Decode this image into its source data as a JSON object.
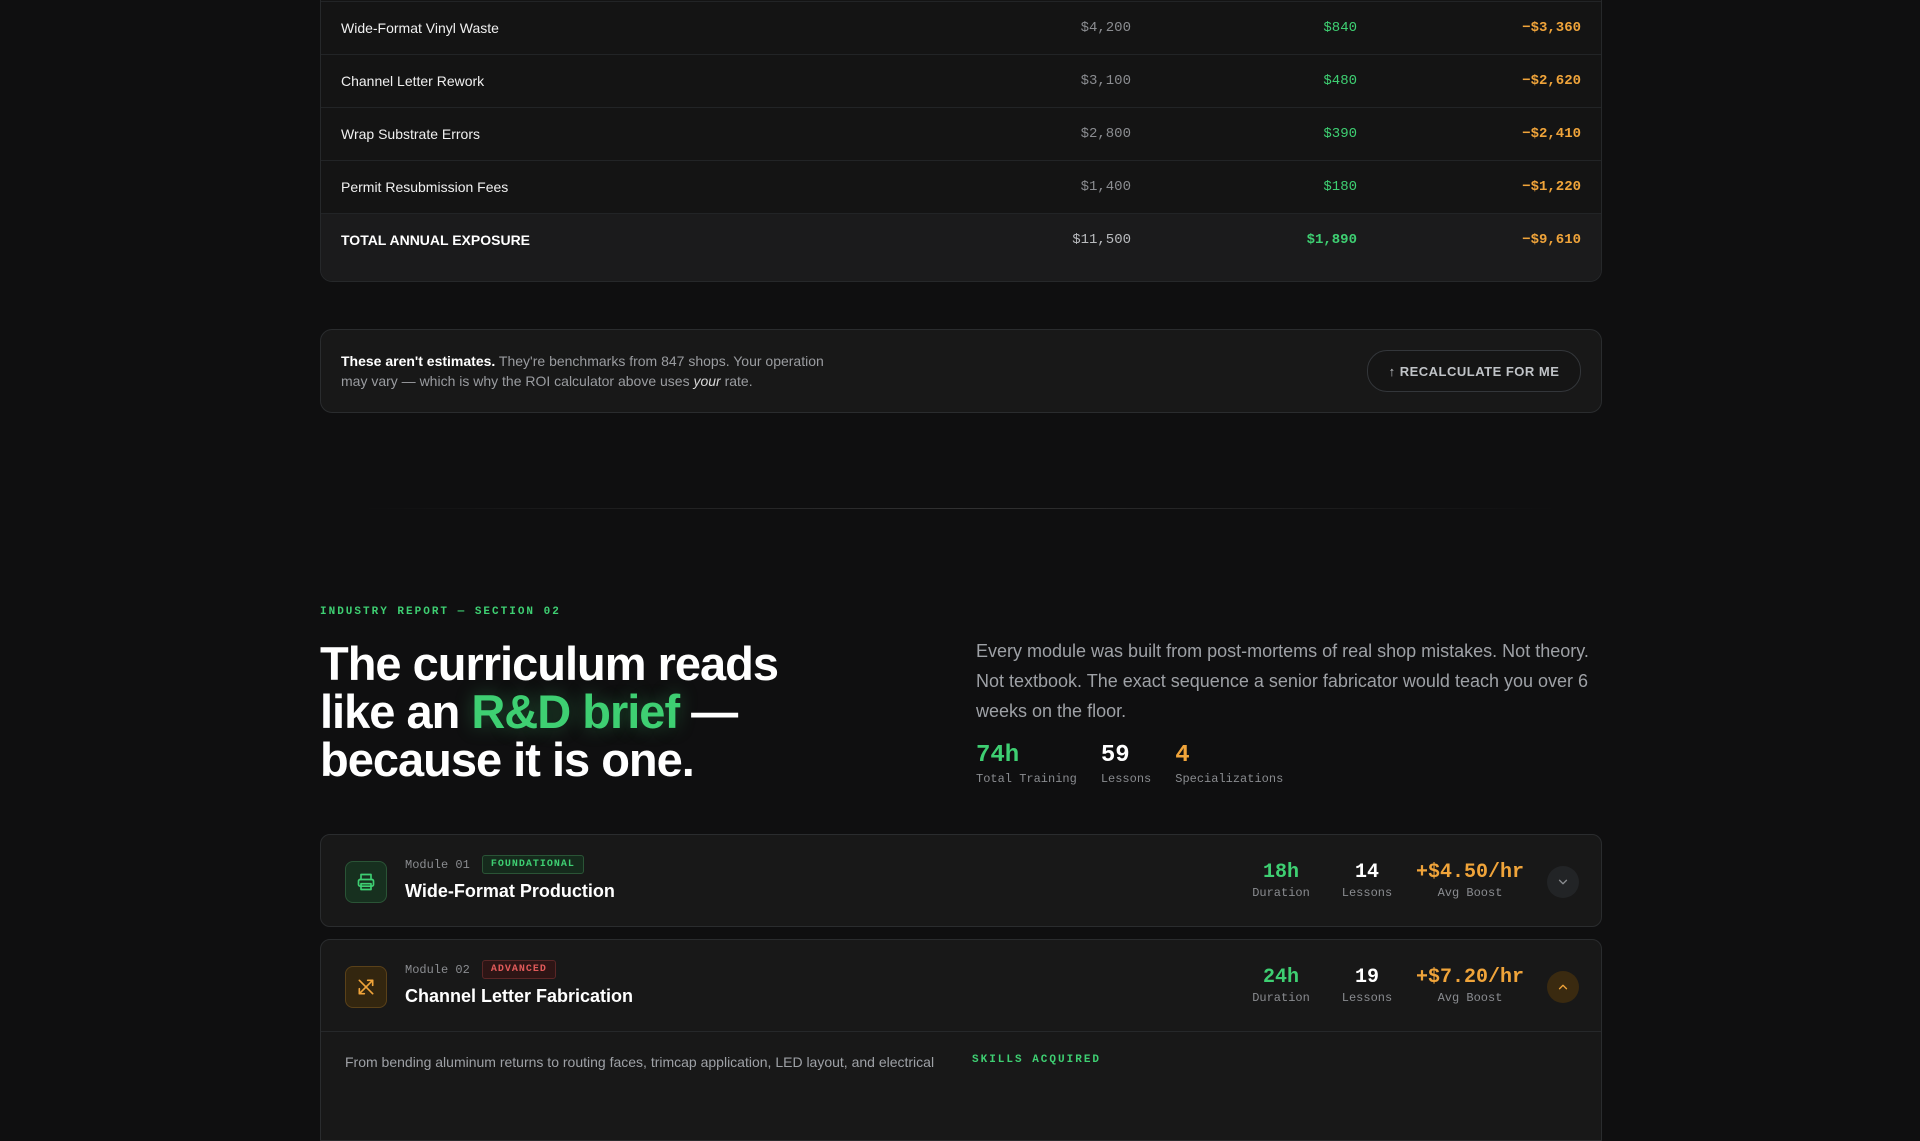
{
  "savings_table": {
    "rows": [
      {
        "name": "Wide-Format Vinyl Waste",
        "before": "$4,200",
        "after": "$840",
        "delta": "−$3,360"
      },
      {
        "name": "Channel Letter Rework",
        "before": "$3,100",
        "after": "$480",
        "delta": "−$2,620"
      },
      {
        "name": "Wrap Substrate Errors",
        "before": "$2,800",
        "after": "$390",
        "delta": "−$2,410"
      },
      {
        "name": "Permit Resubmission Fees",
        "before": "$1,400",
        "after": "$180",
        "delta": "−$1,220"
      }
    ],
    "total": {
      "name": "TOTAL ANNUAL EXPOSURE",
      "before": "$11,500",
      "after": "$1,890",
      "delta": "−$9,610"
    }
  },
  "note": {
    "bold": "These aren't estimates.",
    "text1": " They're benchmarks from 847 shops. Your operation may vary — which is why the ROI calculator above uses ",
    "emph": "your",
    "text2": " rate.",
    "button_label": "↑ RECALCULATE FOR ME"
  },
  "section2": {
    "eyebrow": "INDUSTRY REPORT — SECTION 02",
    "headline": {
      "part1": "The curriculum reads like an ",
      "accent": "R&D brief",
      "part2": " — because it is one."
    },
    "intro": "Every module was built from post-mortems of real shop mistakes. Not theory. Not textbook. The exact sequence a senior fabricator would teach you over 6 weeks on the floor.",
    "stats": [
      {
        "value": "74h",
        "label": "Total Training"
      },
      {
        "value": "59",
        "label": "Lessons"
      },
      {
        "value": "4",
        "label": "Specializations"
      }
    ]
  },
  "modules": [
    {
      "number": "Module 01",
      "badge": "FOUNDATIONAL",
      "title": "Wide-Format Production",
      "icon": "printer-icon",
      "duration": "18h",
      "duration_label": "Duration",
      "lessons": "14",
      "lessons_label": "Lessons",
      "boost": "+$4.50/hr",
      "boost_label": "Avg Boost",
      "expanded": false
    },
    {
      "number": "Module 02",
      "badge": "ADVANCED",
      "title": "Channel Letter Fabrication",
      "icon": "tools-icon",
      "duration": "24h",
      "duration_label": "Duration",
      "lessons": "19",
      "lessons_label": "Lessons",
      "boost": "+$7.20/hr",
      "boost_label": "Avg Boost",
      "expanded": true,
      "description": "From bending aluminum returns to routing faces, trimcap application, LED layout, and electrical",
      "skills_heading": "SKILLS ACQUIRED"
    }
  ],
  "colors": {
    "accent_green": "#3ecf72",
    "accent_orange": "#f0a43a",
    "advanced_red": "#e05a5a"
  }
}
